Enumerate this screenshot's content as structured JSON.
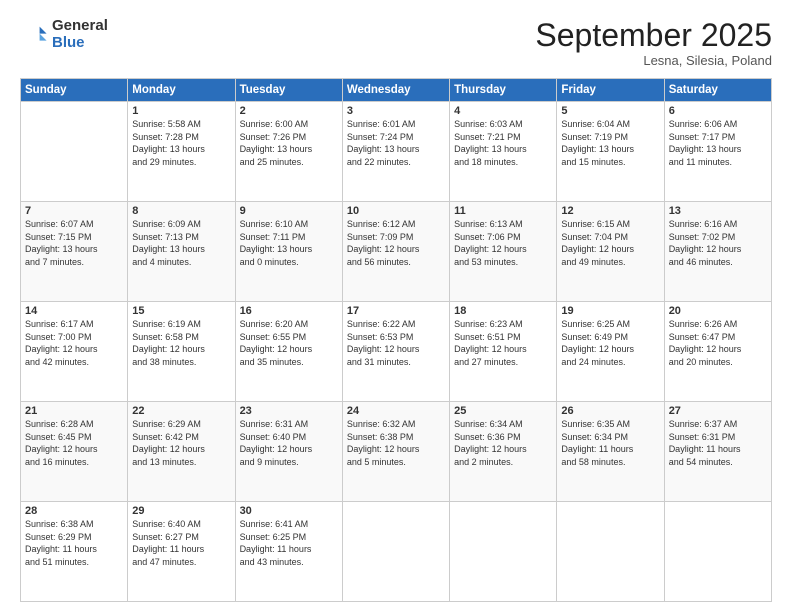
{
  "logo": {
    "general": "General",
    "blue": "Blue"
  },
  "title": "September 2025",
  "subtitle": "Lesna, Silesia, Poland",
  "days_header": [
    "Sunday",
    "Monday",
    "Tuesday",
    "Wednesday",
    "Thursday",
    "Friday",
    "Saturday"
  ],
  "weeks": [
    [
      {
        "day": "",
        "info": ""
      },
      {
        "day": "1",
        "info": "Sunrise: 5:58 AM\nSunset: 7:28 PM\nDaylight: 13 hours\nand 29 minutes."
      },
      {
        "day": "2",
        "info": "Sunrise: 6:00 AM\nSunset: 7:26 PM\nDaylight: 13 hours\nand 25 minutes."
      },
      {
        "day": "3",
        "info": "Sunrise: 6:01 AM\nSunset: 7:24 PM\nDaylight: 13 hours\nand 22 minutes."
      },
      {
        "day": "4",
        "info": "Sunrise: 6:03 AM\nSunset: 7:21 PM\nDaylight: 13 hours\nand 18 minutes."
      },
      {
        "day": "5",
        "info": "Sunrise: 6:04 AM\nSunset: 7:19 PM\nDaylight: 13 hours\nand 15 minutes."
      },
      {
        "day": "6",
        "info": "Sunrise: 6:06 AM\nSunset: 7:17 PM\nDaylight: 13 hours\nand 11 minutes."
      }
    ],
    [
      {
        "day": "7",
        "info": "Sunrise: 6:07 AM\nSunset: 7:15 PM\nDaylight: 13 hours\nand 7 minutes."
      },
      {
        "day": "8",
        "info": "Sunrise: 6:09 AM\nSunset: 7:13 PM\nDaylight: 13 hours\nand 4 minutes."
      },
      {
        "day": "9",
        "info": "Sunrise: 6:10 AM\nSunset: 7:11 PM\nDaylight: 13 hours\nand 0 minutes."
      },
      {
        "day": "10",
        "info": "Sunrise: 6:12 AM\nSunset: 7:09 PM\nDaylight: 12 hours\nand 56 minutes."
      },
      {
        "day": "11",
        "info": "Sunrise: 6:13 AM\nSunset: 7:06 PM\nDaylight: 12 hours\nand 53 minutes."
      },
      {
        "day": "12",
        "info": "Sunrise: 6:15 AM\nSunset: 7:04 PM\nDaylight: 12 hours\nand 49 minutes."
      },
      {
        "day": "13",
        "info": "Sunrise: 6:16 AM\nSunset: 7:02 PM\nDaylight: 12 hours\nand 46 minutes."
      }
    ],
    [
      {
        "day": "14",
        "info": "Sunrise: 6:17 AM\nSunset: 7:00 PM\nDaylight: 12 hours\nand 42 minutes."
      },
      {
        "day": "15",
        "info": "Sunrise: 6:19 AM\nSunset: 6:58 PM\nDaylight: 12 hours\nand 38 minutes."
      },
      {
        "day": "16",
        "info": "Sunrise: 6:20 AM\nSunset: 6:55 PM\nDaylight: 12 hours\nand 35 minutes."
      },
      {
        "day": "17",
        "info": "Sunrise: 6:22 AM\nSunset: 6:53 PM\nDaylight: 12 hours\nand 31 minutes."
      },
      {
        "day": "18",
        "info": "Sunrise: 6:23 AM\nSunset: 6:51 PM\nDaylight: 12 hours\nand 27 minutes."
      },
      {
        "day": "19",
        "info": "Sunrise: 6:25 AM\nSunset: 6:49 PM\nDaylight: 12 hours\nand 24 minutes."
      },
      {
        "day": "20",
        "info": "Sunrise: 6:26 AM\nSunset: 6:47 PM\nDaylight: 12 hours\nand 20 minutes."
      }
    ],
    [
      {
        "day": "21",
        "info": "Sunrise: 6:28 AM\nSunset: 6:45 PM\nDaylight: 12 hours\nand 16 minutes."
      },
      {
        "day": "22",
        "info": "Sunrise: 6:29 AM\nSunset: 6:42 PM\nDaylight: 12 hours\nand 13 minutes."
      },
      {
        "day": "23",
        "info": "Sunrise: 6:31 AM\nSunset: 6:40 PM\nDaylight: 12 hours\nand 9 minutes."
      },
      {
        "day": "24",
        "info": "Sunrise: 6:32 AM\nSunset: 6:38 PM\nDaylight: 12 hours\nand 5 minutes."
      },
      {
        "day": "25",
        "info": "Sunrise: 6:34 AM\nSunset: 6:36 PM\nDaylight: 12 hours\nand 2 minutes."
      },
      {
        "day": "26",
        "info": "Sunrise: 6:35 AM\nSunset: 6:34 PM\nDaylight: 11 hours\nand 58 minutes."
      },
      {
        "day": "27",
        "info": "Sunrise: 6:37 AM\nSunset: 6:31 PM\nDaylight: 11 hours\nand 54 minutes."
      }
    ],
    [
      {
        "day": "28",
        "info": "Sunrise: 6:38 AM\nSunset: 6:29 PM\nDaylight: 11 hours\nand 51 minutes."
      },
      {
        "day": "29",
        "info": "Sunrise: 6:40 AM\nSunset: 6:27 PM\nDaylight: 11 hours\nand 47 minutes."
      },
      {
        "day": "30",
        "info": "Sunrise: 6:41 AM\nSunset: 6:25 PM\nDaylight: 11 hours\nand 43 minutes."
      },
      {
        "day": "",
        "info": ""
      },
      {
        "day": "",
        "info": ""
      },
      {
        "day": "",
        "info": ""
      },
      {
        "day": "",
        "info": ""
      }
    ]
  ]
}
